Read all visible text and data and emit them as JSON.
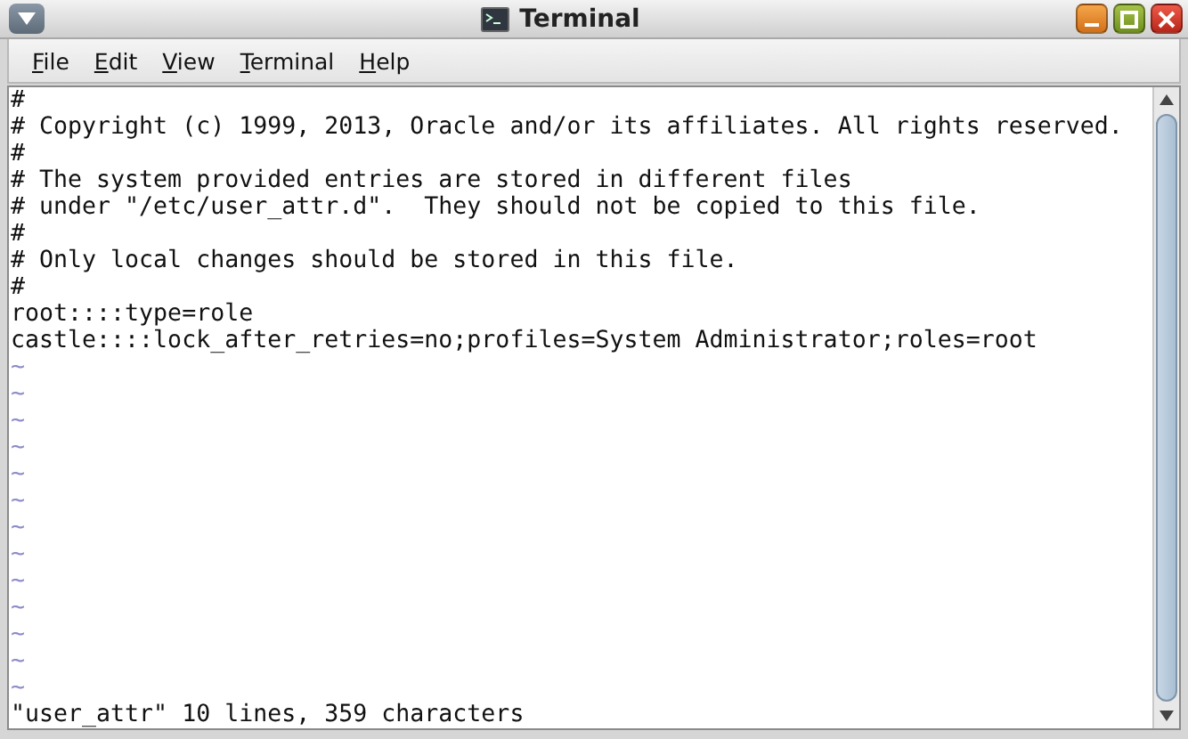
{
  "window": {
    "title": "Terminal"
  },
  "menu": [
    "File",
    "Edit",
    "View",
    "Terminal",
    "Help"
  ],
  "lines": [
    {
      "kind": "text",
      "text": "#"
    },
    {
      "kind": "text",
      "text": "# Copyright (c) 1999, 2013, Oracle and/or its affiliates. All rights reserved."
    },
    {
      "kind": "text",
      "text": "#"
    },
    {
      "kind": "text",
      "text": "# The system provided entries are stored in different files"
    },
    {
      "kind": "text",
      "text": "# under \"/etc/user_attr.d\".  They should not be copied to this file."
    },
    {
      "kind": "text",
      "text": "#"
    },
    {
      "kind": "text",
      "text": "# Only local changes should be stored in this file."
    },
    {
      "kind": "text",
      "text": "#"
    },
    {
      "kind": "text",
      "text": "root::::type=role"
    },
    {
      "kind": "text",
      "text": "castle::::lock_after_retries=no;profiles=System Administrator;roles=root"
    },
    {
      "kind": "tilde",
      "text": "~"
    },
    {
      "kind": "tilde",
      "text": "~"
    },
    {
      "kind": "tilde",
      "text": "~"
    },
    {
      "kind": "tilde",
      "text": "~"
    },
    {
      "kind": "tilde",
      "text": "~"
    },
    {
      "kind": "tilde",
      "text": "~"
    },
    {
      "kind": "tilde",
      "text": "~"
    },
    {
      "kind": "tilde",
      "text": "~"
    },
    {
      "kind": "tilde",
      "text": "~"
    },
    {
      "kind": "tilde",
      "text": "~"
    },
    {
      "kind": "tilde",
      "text": "~"
    },
    {
      "kind": "tilde",
      "text": "~"
    },
    {
      "kind": "tilde",
      "text": "~"
    }
  ],
  "status_line": "\"user_attr\" 10 lines, 359 characters"
}
